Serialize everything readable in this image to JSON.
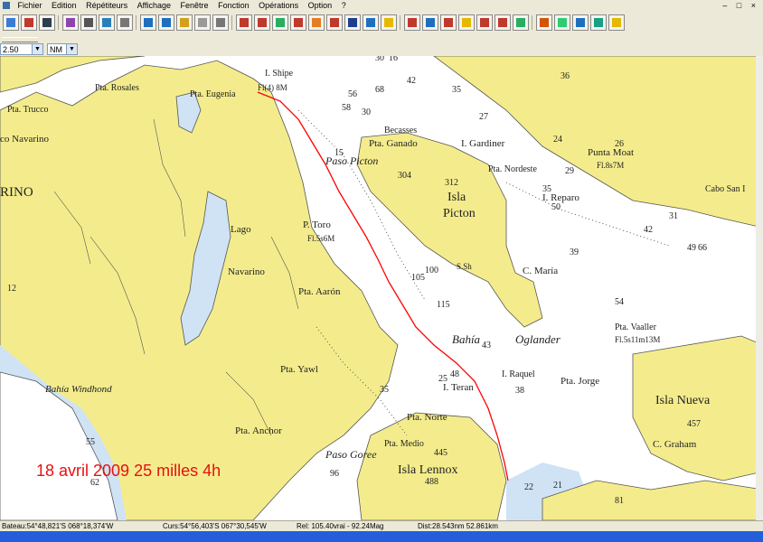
{
  "menu": [
    "Fichier",
    "Edition",
    "Répétiteurs",
    "Affichage",
    "Fenêtre",
    "Fonction",
    "Opérations",
    "Option",
    "?"
  ],
  "toolbar": {
    "icons": [
      "new-icon",
      "print-icon",
      "save-icon",
      "help-cursor-icon",
      "printer-icon",
      "preview-icon",
      "page-icon",
      "zoom-in-icon",
      "zoom-out-icon",
      "hand-icon",
      "select-rect-icon",
      "zoom-rect-icon",
      "boat-icon",
      "target-icon",
      "route-icon",
      "track-icon",
      "waypoint-icon",
      "edit-route-icon",
      "text-icon",
      "window-icon",
      "layer-icon",
      "gps-icon",
      "compass-icon",
      "mob-icon",
      "route-tool-icon",
      "wind-icon",
      "lifebuoy-icon",
      "chart-icon",
      "grid-icon",
      "tide-icon",
      "measure-icon",
      "weather-icon",
      "about-icon"
    ]
  },
  "toolbar2": {
    "speed_value": "2.50",
    "unit_value": "NM"
  },
  "map": {
    "annotation": "18 avril 2009 25 milles 4h",
    "labels": {
      "rino": "RINO",
      "co_navarino": "co Navarino",
      "pta_trucco": "Pta. Trucco",
      "pta_rosales": "Pta. Rosales",
      "pta_eugenia": "Pta. Eugenia",
      "i_shipe": "I. Shipe",
      "fl4_8m": "Fl(4) 8M",
      "becasses": "Becasses",
      "pta_ganado": "Pta. Ganado",
      "i_gardiner": "I. Gardiner",
      "punta_moat": "Punta Moat",
      "fl8s7m": "Fl.8s7M",
      "cabo_san": "Cabo San I",
      "isla_picton": "Isla",
      "isla_picton2": "Picton",
      "num_304": "304",
      "num_312": "312",
      "pta_nordeste": "Pta. Nordeste",
      "i_reparo": "I. Reparo",
      "paso_picton": "Paso Picton",
      "p_toro": "P. Toro",
      "fl5s6m": "Fl.5s6M",
      "lago": "Lago",
      "navarino": "Navarino",
      "pta_aaron": "Pta. Aarón",
      "c_maria": "C. María",
      "bahia": "Bahía",
      "oglander": "Oglander",
      "pta_vaaller": "Pta. Vaaller",
      "fl5s11m": "Fl.5s11m13M",
      "pta_yawl": "Pta. Yawl",
      "i_teran": "I. Teran",
      "i_raquel": "I. Raquel",
      "pta_jorge": "Pta. Jorge",
      "isla_nueva": "Isla Nueva",
      "num_457": "457",
      "c_graham": "C. Graham",
      "bahia_windhond": "Bahía Windhond",
      "pta_anchor": "Pta. Anchor",
      "pta_norte": "Pta. Norte",
      "pta_medio": "Pta. Medio",
      "num_445": "445",
      "isla_lennox": "Isla Lennox",
      "num_488": "488",
      "paso_goree": "Paso Goree",
      "s_sh": "S.Sh"
    },
    "depths": [
      "36",
      "35",
      "27",
      "24",
      "30",
      "26",
      "56",
      "58",
      "68",
      "15",
      "42",
      "16",
      "30",
      "29",
      "35",
      "31",
      "42",
      "66",
      "49",
      "50",
      "39",
      "105",
      "100",
      "115",
      "54",
      "43",
      "48",
      "25",
      "38",
      "35",
      "22",
      "55",
      "12",
      "96",
      "62",
      "21",
      "81"
    ]
  },
  "status": {
    "bateau": "Bateau:54°48,821'S 068°18,374'W",
    "curs": "Curs:54°56,403'S 067°30,545'W",
    "rel": "Rel: 105.40vrai - 92.24Mag",
    "dist": "Dist:28.543nm  52.861km"
  },
  "colors": {
    "land": "#f4ec8c",
    "sea": "#ffffff",
    "shallow": "#cfe3f5",
    "route": "#ff0000",
    "annotation": "#e81010"
  }
}
